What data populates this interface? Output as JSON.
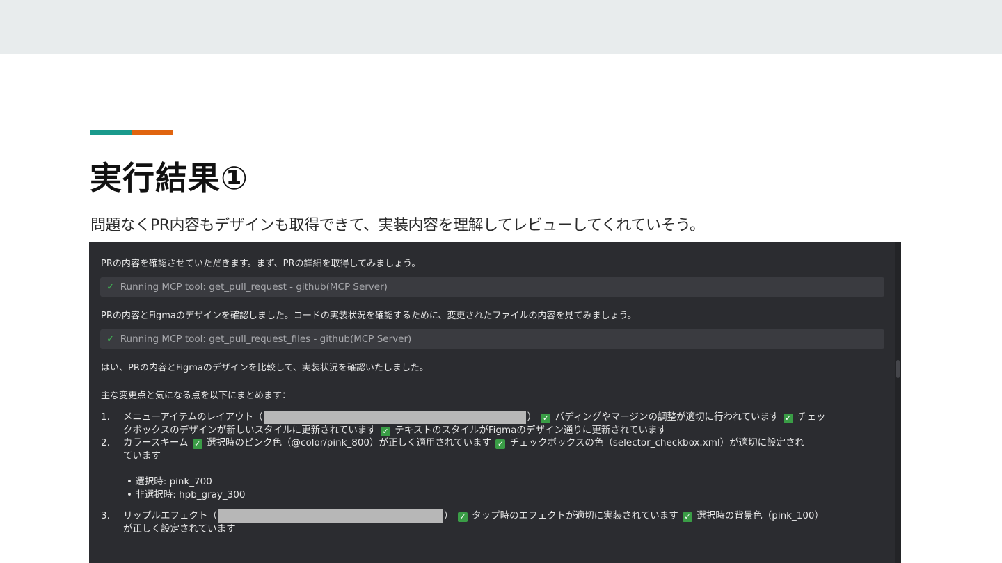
{
  "slide": {
    "title": "実行結果①",
    "subtitle": "問題なくPR内容もデザインも取得できて、実装内容を理解してレビューしてくれていそう。",
    "colors": {
      "accent_teal": "#1a9a8c",
      "accent_orange": "#e0640f",
      "panel_bg": "#2b2c30",
      "check_green": "#3a9d46"
    }
  },
  "chat": {
    "msg1": "PRの内容を確認させていただきます。まず、PRの詳細を取得してみましょう。",
    "tool1": "Running MCP tool: get_pull_request - github(MCP Server)",
    "msg2": "PRの内容とFigmaのデザインを確認しました。コードの実装状況を確認するために、変更されたファイルの内容を見てみましょう。",
    "tool2": "Running MCP tool: get_pull_request_files - github(MCP Server)",
    "msg3": "はい、PRの内容とFigmaのデザインを比較して、実装状況を確認いたしました。",
    "msg4": "主な変更点と気になる点を以下にまとめます：",
    "items": [
      {
        "num": "1.",
        "a": "メニューアイテムのレイアウト（",
        "b": "）",
        "c": "パディングやマージンの調整が適切に行われています",
        "d": "チェッ",
        "e": "クボックスのデザインが新しいスタイルに更新されています",
        "f": "テキストのスタイルがFigmaのデザイン通りに更新されています"
      },
      {
        "num": "2.",
        "a": "カラースキーム",
        "b": "選択時のピンク色（@color/pink_800）が正しく適用されています",
        "c": "チェックボックスの色（selector_checkbox.xml）が適切に設定され",
        "d": "ています"
      },
      {
        "num": "3.",
        "a": "リップルエフェクト（",
        "b": "）",
        "c": "タップ時のエフェクトが適切に実装されています",
        "d": "選択時の背景色（pink_100）",
        "e": "が正しく設定されています"
      }
    ],
    "bullets": [
      "• 選択時: pink_700",
      "• 非選択時: hpb_gray_300"
    ],
    "check_glyph": "✓"
  }
}
